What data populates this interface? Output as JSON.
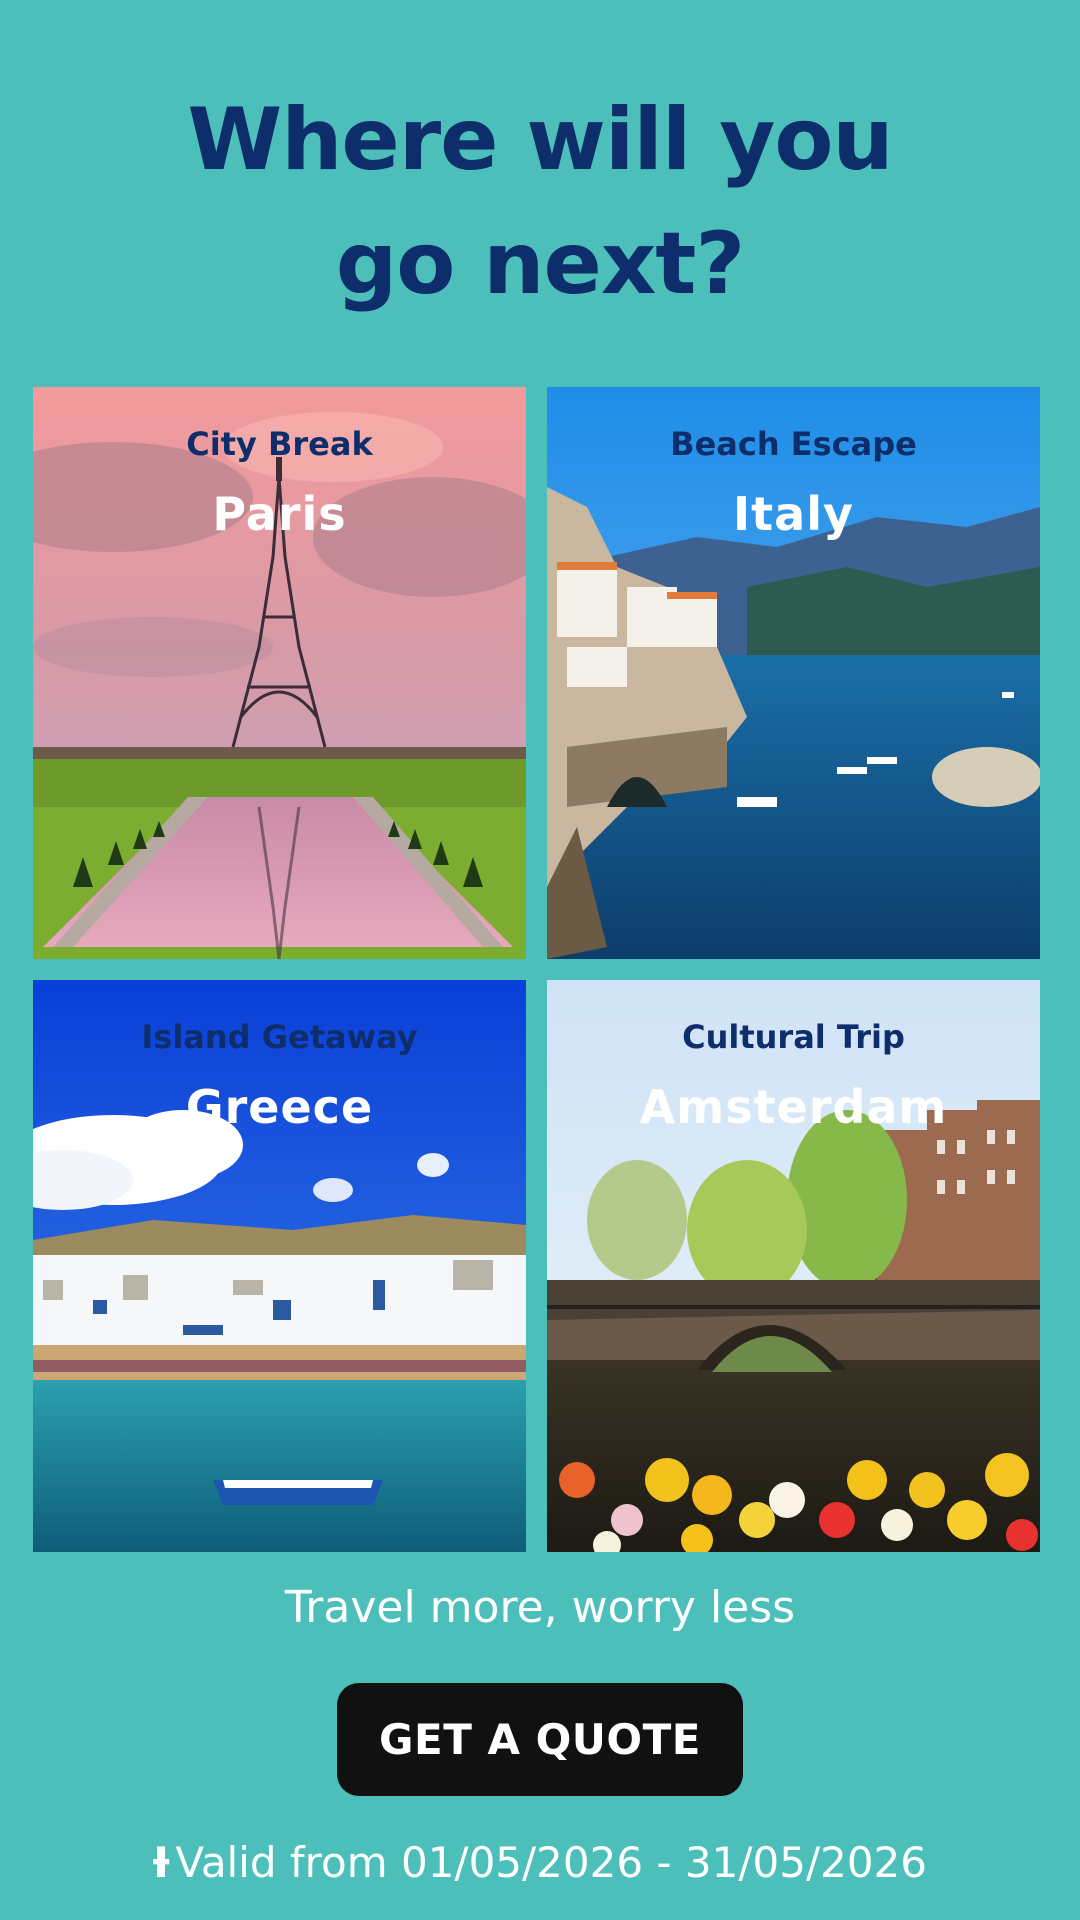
{
  "headline": {
    "line1": "Where will you",
    "line2": "go next?"
  },
  "cards": [
    {
      "category": "City Break",
      "destination": "Paris"
    },
    {
      "category": "Beach Escape",
      "destination": "Italy"
    },
    {
      "category": "Island Getaway",
      "destination": "Greece"
    },
    {
      "category": "Cultural Trip",
      "destination": "Amsterdam"
    }
  ],
  "tagline": "Travel more, worry less",
  "cta": {
    "label": "GET A QUOTE"
  },
  "validity": {
    "icon": "Ɨ",
    "text": "Valid from 01/05/2026 - 31/05/2026"
  },
  "colors": {
    "background": "#4cbfbb",
    "headline": "#0d2e6b",
    "button": "#111111"
  }
}
